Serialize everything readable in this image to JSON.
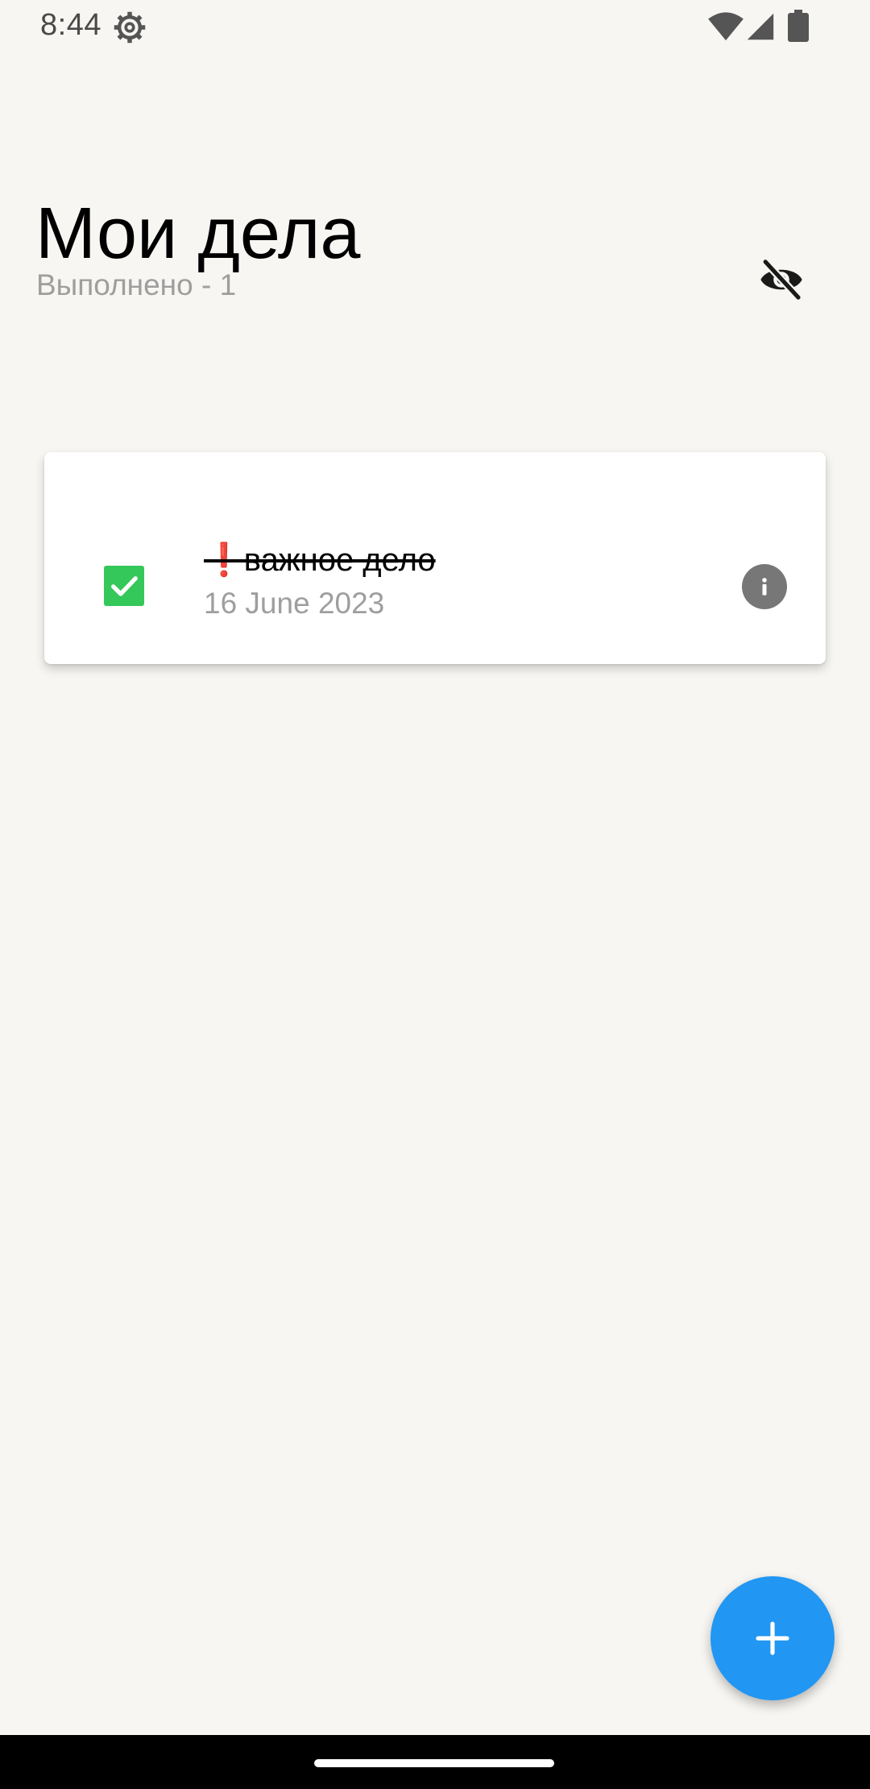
{
  "status_bar": {
    "time": "8:44",
    "icons": [
      "settings-gear-icon",
      "wifi-icon",
      "cell-signal-icon",
      "battery-icon"
    ]
  },
  "header": {
    "title": "Мои дела",
    "done_count": "Выполнено - 1",
    "visibility_toggle_icon": "eye-off-icon"
  },
  "tasks": [
    {
      "checked": true,
      "priority_icon": "❗",
      "title": "❗важное дело",
      "date": "16 June 2023",
      "info_icon": "info-icon"
    }
  ],
  "fab": {
    "icon": "plus-icon"
  },
  "colors": {
    "background": "#F7F6F2",
    "checkbox_checked": "#34C759",
    "fab": "#2196F3",
    "secondary_text": "#9E9E9E",
    "info_icon": "#777777"
  }
}
